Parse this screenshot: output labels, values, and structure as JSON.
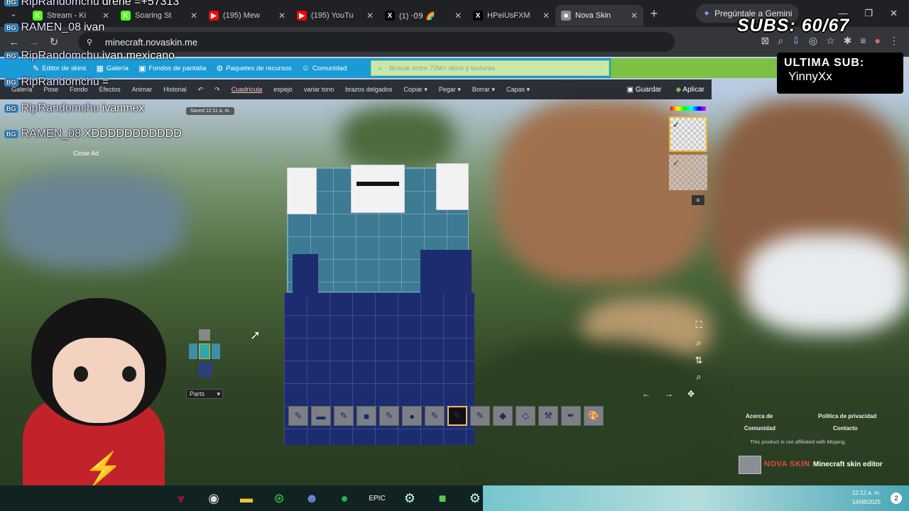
{
  "browser": {
    "tabs": [
      {
        "title": "Stream - Ki",
        "icon": "kick-icon",
        "color": "#53fc18",
        "glyph": "K"
      },
      {
        "title": "Soaring St",
        "icon": "kick-icon",
        "color": "#53fc18",
        "glyph": "K"
      },
      {
        "title": "(195) Mew",
        "icon": "youtube-icon",
        "color": "#ff0000",
        "glyph": "▶"
      },
      {
        "title": "(195) YouTu",
        "icon": "youtube-icon",
        "color": "#ff0000",
        "glyph": "▶"
      },
      {
        "title": "(1) ⋅𝟢𝟫 🌈",
        "icon": "x-icon",
        "color": "#000000",
        "glyph": "X"
      },
      {
        "title": "HPeiUsFXM",
        "icon": "x-icon",
        "color": "#000000",
        "glyph": "X"
      },
      {
        "title": "Nova Skin",
        "icon": "novaskin-icon",
        "color": "#8a8f95",
        "glyph": "■",
        "active": true
      }
    ],
    "new_tab": "+",
    "gemini_label": "Pregúntale a Gemini",
    "url": "minecraft.novaskin.me"
  },
  "site": {
    "nav": [
      {
        "label": "Editor de skins",
        "icon": "edit-icon",
        "glyph": "✎"
      },
      {
        "label": "Galería",
        "icon": "gallery-icon",
        "glyph": "▦"
      },
      {
        "label": "Fondos de pantalla",
        "icon": "wallpaper-icon",
        "glyph": "▣"
      },
      {
        "label": "Paquetes de recursos",
        "icon": "gear-icon",
        "glyph": "⚙"
      },
      {
        "label": "Comunidad",
        "icon": "community-icon",
        "glyph": "☺"
      }
    ],
    "search_placeholder": "Buscar entre 70M+ skins y texturas",
    "toolbar": [
      {
        "label": "Galería"
      },
      {
        "label": "Pose"
      },
      {
        "label": "Fondo"
      },
      {
        "label": "Efectos"
      },
      {
        "label": "Animar"
      },
      {
        "label": "Historial"
      },
      {
        "label": "↶"
      },
      {
        "label": "↷"
      },
      {
        "label": "Cuadrícula",
        "hl": true
      },
      {
        "label": "espejo"
      },
      {
        "label": "variar tono"
      },
      {
        "label": "brazos delgados"
      },
      {
        "label": "Copiar ▾"
      },
      {
        "label": "Pegar ▾"
      },
      {
        "label": "Borrar ▾"
      },
      {
        "label": "Capas ▾"
      }
    ],
    "save_label": "Guardar",
    "apply_label": "Aplicar",
    "saved_status": "Saved 12:11 a. m.",
    "parts_label": "Parts",
    "footer": {
      "about": "Acerca de",
      "privacy": "Política de privacidad",
      "community": "Comunidad",
      "contact": "Contacto",
      "notice": "This product is not affiliated with Mojang.",
      "brand": "NOVA SKIN",
      "tagline": "Minecraft skin editor"
    },
    "tools": [
      {
        "name": "pencil-icon",
        "glyph": "✎"
      },
      {
        "name": "bar-icon",
        "glyph": "▬"
      },
      {
        "name": "pencil-icon",
        "glyph": "✎"
      },
      {
        "name": "square-icon",
        "glyph": "■"
      },
      {
        "name": "pencil-icon",
        "glyph": "✎"
      },
      {
        "name": "circle-icon",
        "glyph": "●"
      },
      {
        "name": "pencil-icon",
        "glyph": "✎"
      },
      {
        "name": "pencil-icon",
        "glyph": "✎",
        "selected": true
      },
      {
        "name": "pencil-icon",
        "glyph": "✎"
      },
      {
        "name": "fill-icon",
        "glyph": "◆"
      },
      {
        "name": "eraser-icon",
        "glyph": "◇"
      },
      {
        "name": "stamp-icon",
        "glyph": "⚒"
      },
      {
        "name": "eyedropper-icon",
        "glyph": "✒"
      },
      {
        "name": "palette-icon",
        "glyph": "🎨"
      }
    ]
  },
  "stream": {
    "chat": [
      {
        "user": "RipRandomchu",
        "text": "drene =+57313"
      },
      {
        "user": "RAMEN_08",
        "text": "ivan"
      },
      {
        "user": "RipRandomchu",
        "text": "ivan mexicano"
      },
      {
        "user": "RipRandomchu",
        "text": "="
      },
      {
        "user": "RipRandomchu",
        "text": "ivanmex"
      },
      {
        "user": "RAMEN_08",
        "text": "XDDDDDDDDDDD"
      }
    ],
    "close_ad": "Close Ad",
    "subs_label": "SUBS: 60/67",
    "last_sub_title": "ULTIMA SUB:",
    "last_sub_user": "YinnyXx"
  },
  "taskbar": {
    "clock_time": "12:12 a. m.",
    "clock_date": "14/08/2025",
    "notifications": "2"
  }
}
